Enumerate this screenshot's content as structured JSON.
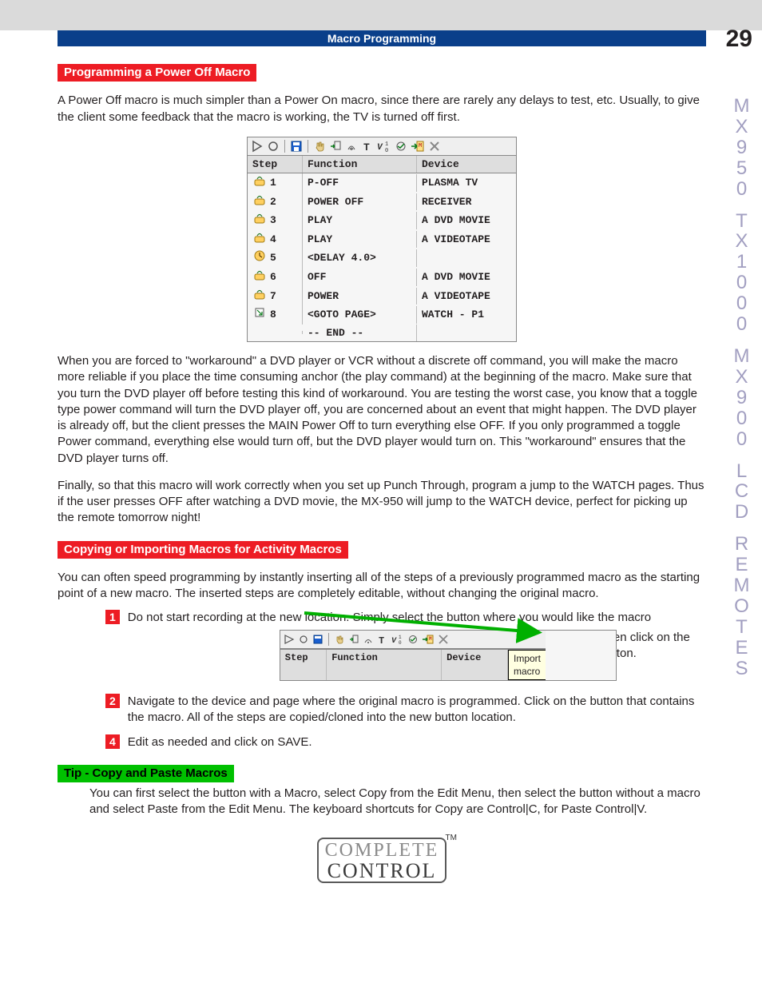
{
  "header": {
    "section": "Macro Programming",
    "pageNumber": "29"
  },
  "sideTab": "MX950 TX1000 MX900 LCD REMOTES",
  "section1": {
    "title": "Programming a Power Off Macro",
    "intro": "A Power Off macro is much simpler than a Power On macro, since there are rarely any delays to test, etc. Usually, to give the client some feedback that the macro is working, the TV is turned off first.",
    "macro": {
      "headers": {
        "step": "Step",
        "function": "Function",
        "device": "Device"
      },
      "rows": [
        {
          "icon": "ir",
          "n": "1",
          "fn": "P-OFF",
          "dev": "PLASMA TV"
        },
        {
          "icon": "ir",
          "n": "2",
          "fn": "POWER OFF",
          "dev": "RECEIVER"
        },
        {
          "icon": "ir",
          "n": "3",
          "fn": "PLAY",
          "dev": "A DVD MOVIE"
        },
        {
          "icon": "ir",
          "n": "4",
          "fn": "PLAY",
          "dev": "A VIDEOTAPE"
        },
        {
          "icon": "delay",
          "n": "5",
          "fn": "<DELAY 4.0>",
          "dev": ""
        },
        {
          "icon": "ir",
          "n": "6",
          "fn": "OFF",
          "dev": "A DVD MOVIE"
        },
        {
          "icon": "ir",
          "n": "7",
          "fn": "POWER",
          "dev": "A VIDEOTAPE"
        },
        {
          "icon": "goto",
          "n": "8",
          "fn": "<GOTO PAGE>",
          "dev": "WATCH - P1"
        },
        {
          "icon": "",
          "n": "",
          "fn": "-- END --",
          "dev": ""
        }
      ]
    },
    "para2": "When you are forced to \"workaround\" a DVD player or  VCR without a discrete off command, you will make the macro more reliable if you place the time consuming anchor (the play command) at the beginning of the macro.  Make sure that you turn the DVD player off before testing this kind of workaround.  You are testing the worst case, you know that a toggle type power command will turn the DVD player off, you are concerned about an event that might happen. The DVD player is already off, but the client presses the MAIN Power Off to turn everything else OFF. If you only programmed a toggle Power command, everything else would turn off, but the DVD player would turn on. This \"workaround\" ensures that the DVD player turns off.",
    "para3": "Finally, so that this macro will work correctly when you set up Punch Through, program a jump to the WATCH pages. Thus if the user presses OFF after watching a DVD movie, the MX-950 will jump to the WATCH device, perfect for picking up the remote tomorrow night!"
  },
  "section2": {
    "title": "Copying or Importing Macros for Activity Macros",
    "intro": "You can often speed programming by instantly inserting all of the steps of a previously programmed macro as the starting point of a new macro. The inserted steps are completely editable, without changing the original macro.",
    "steps": [
      {
        "n": "1",
        "text_a": "Do not start recording at the new location. Simply select the button where you would like the macro",
        "text_b": "inserted. Then click on the IMPORT button."
      },
      {
        "n": "2",
        "text": "Navigate to the device and page where the original macro is programmed. Click on the button that contains the macro. All of the steps are copied/cloned into the new button location."
      },
      {
        "n": "4",
        "text": "Edit as needed and click on SAVE."
      }
    ],
    "miniHeaders": {
      "step": "Step",
      "function": "Function",
      "device": "Device",
      "tooltip": "Import macro"
    }
  },
  "tip": {
    "title": "Tip - Copy and Paste Macros",
    "body": "You can first select the button with a Macro, select Copy from the Edit Menu, then select the button without a macro and select Paste from the Edit Menu. The keyboard shortcuts for Copy are Control|C, for Paste Control|V."
  },
  "footer": {
    "line1": "COMPLETE",
    "line2": "CONTROL",
    "tm": "TM"
  },
  "icons": {
    "play": "play-icon",
    "record": "record-icon",
    "save": "save-icon",
    "hand": "hand-icon",
    "jump": "jump-icon",
    "rf": "rf-icon",
    "text": "text-icon",
    "var": "var-icon",
    "relay": "relay-icon",
    "import": "import-icon",
    "delete": "delete-icon"
  }
}
